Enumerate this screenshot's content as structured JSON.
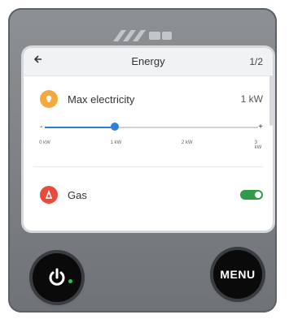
{
  "header": {
    "back_icon": "back-arrow-icon",
    "title": "Energy",
    "page_indicator": "1/2"
  },
  "settings": {
    "electricity": {
      "icon": "lightbulb-icon",
      "label": "Max electricity",
      "value": "1 kW",
      "slider": {
        "min_label": "-",
        "max_label": "+",
        "ticks": [
          "0 kW",
          "1 kW",
          "2 kW",
          "3 kW"
        ],
        "level_fraction": 0.33
      }
    },
    "gas": {
      "icon": "gas-flame-icon",
      "label": "Gas",
      "toggle_on": true
    }
  },
  "hardware": {
    "power_icon": "power-icon",
    "power_indicator_color": "#2cc24a",
    "menu_label": "MENU"
  },
  "colors": {
    "accent": "#2f7fd6",
    "toggle_on": "#2e9b4a",
    "electricity_icon": "#f4a940",
    "gas_icon": "#e64c3c"
  }
}
